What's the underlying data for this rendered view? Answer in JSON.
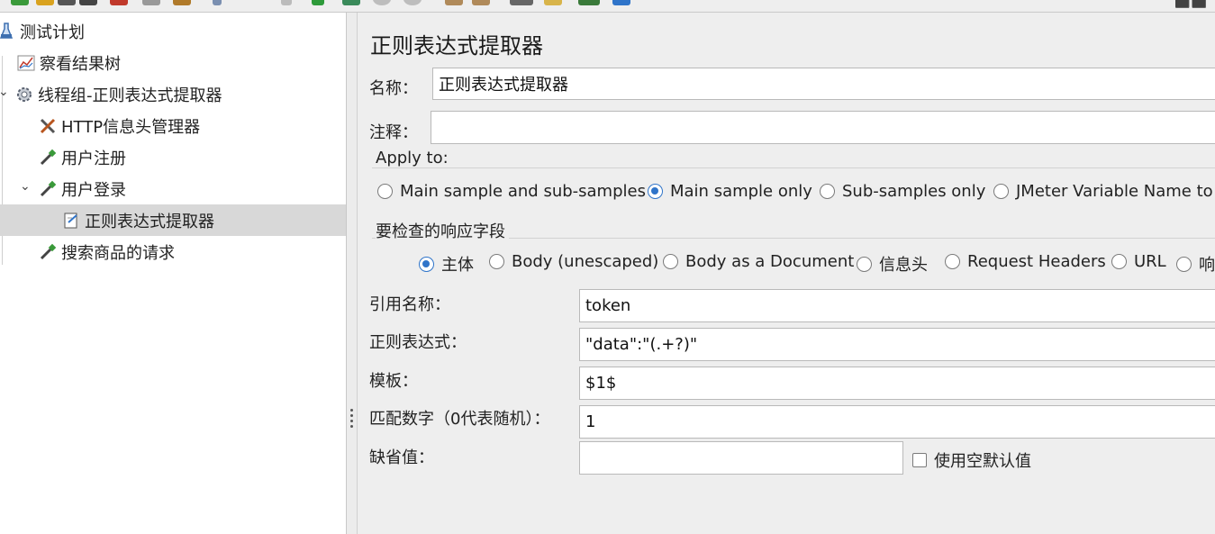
{
  "tree": {
    "items": [
      {
        "label": "测试计划",
        "icon": "test-plan-icon"
      },
      {
        "label": "察看结果树",
        "icon": "result-tree-icon"
      },
      {
        "label": "线程组-正则表达式提取器",
        "icon": "thread-group-gear-icon"
      },
      {
        "label": "HTTP信息头管理器",
        "icon": "tools-icon"
      },
      {
        "label": "用户注册",
        "icon": "sampler-pipette-icon"
      },
      {
        "label": "用户登录",
        "icon": "sampler-pipette-icon"
      },
      {
        "label": "正则表达式提取器",
        "icon": "extractor-document-icon"
      },
      {
        "label": "搜索商品的请求",
        "icon": "sampler-pipette-icon"
      }
    ]
  },
  "panel": {
    "title": "正则表达式提取器",
    "name_label": "名称：",
    "name_value": "正则表达式提取器",
    "comment_label": "注释：",
    "comment_value": "",
    "apply_to": {
      "legend": "Apply to:",
      "options": [
        "Main sample and sub-samples",
        "Main sample only",
        "Sub-samples only",
        "JMeter Variable Name to"
      ],
      "selected": "Main sample only"
    },
    "field_to_check": {
      "legend": "要检查的响应字段",
      "options": [
        "主体",
        "Body (unescaped)",
        "Body as a Document",
        "信息头",
        "Request Headers",
        "URL",
        "响"
      ],
      "selected": "主体"
    },
    "ref_name_label": "引用名称：",
    "ref_name_value": "token",
    "regex_label": "正则表达式：",
    "regex_value": "\"data\":\"(.+?)\"",
    "template_label": "模板：",
    "template_value": "$1$",
    "match_no_label": "匹配数字（0代表随机）：",
    "match_no_value": "1",
    "default_label": "缺省值：",
    "default_value": "",
    "use_empty_default_label": "使用空默认值",
    "use_empty_default_checked": false
  },
  "colors": {
    "accent": "#2f74c9",
    "panel_bg": "#eeeeee",
    "selected_row": "#d8d8d8"
  }
}
